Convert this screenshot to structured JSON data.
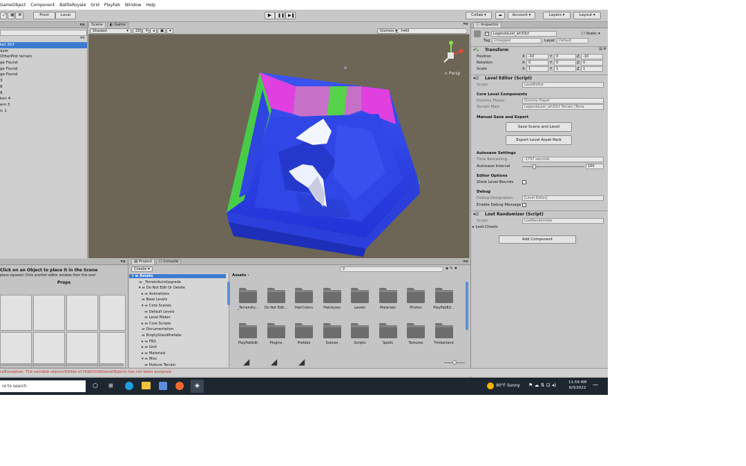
{
  "menu": {
    "items": [
      "GameObject",
      "Component",
      "BattleRoyale",
      "Grid",
      "PlayFab",
      "Window",
      "Help"
    ]
  },
  "toolbar": {
    "pivot": "Pivot",
    "local": "Local",
    "collab": "Collab",
    "account": "Account",
    "layers": "Layers",
    "layout": "Layout"
  },
  "hierarchy": {
    "rows": [
      "ket 3fcf",
      "ayer",
      "OtherPlot terrain",
      "ge Found",
      "ge Found",
      "ge Found",
      "3",
      "8",
      "8",
      "kon 4",
      "ern 3",
      "ic 1"
    ],
    "selected_index": 0
  },
  "scene": {
    "tab_scene": "Scene",
    "tab_game": "Game",
    "shaded": "Shaded",
    "mode_2d": "2D",
    "gizmos": "Gizmos",
    "search": "All",
    "persp": "< Persp"
  },
  "inspector": {
    "tab": "Inspector",
    "object_name": "LegendsLost_wh33cf",
    "static": "Static",
    "tag_label": "Tag",
    "tag_value": "Untagged",
    "layer_label": "Layer",
    "layer_value": "Default",
    "transform": "Transform",
    "position_label": "Position",
    "rotation_label": "Rotation",
    "scale_label": "Scale",
    "pos": {
      "x": "-10",
      "y": "0",
      "z": "-10"
    },
    "rot": {
      "x": "0",
      "y": "0",
      "z": "0"
    },
    "scl": {
      "x": "1",
      "y": "1",
      "z": "1"
    },
    "level_editor": "Level Editor (Script)",
    "script_label": "Script",
    "script_value": "LevelEditor",
    "core_components": "Core Level Components",
    "dummy_label": "Dummy Player",
    "dummy_value": "Dummy Player",
    "terrain_label": "Terrain Main",
    "terrain_value": "LegendsLost_wh33cf Terrain (Terra",
    "manual_save": "Manual Save and Export",
    "save_btn": "Save Scene and Level",
    "export_btn": "Export Level Asset Pack",
    "autosave": "Autosave Settings",
    "time_label": "Time Remaining",
    "time_value": "-1737 seconds",
    "interval_label": "Autosave Interval",
    "interval_value": "100",
    "editor_options": "Editor Options",
    "show_bounds": "Show Level Bounds",
    "debug": "Debug",
    "debug_designation": "Debug Designation",
    "debug_value": "[Level Editor]",
    "enable_debug": "Enable Debug Message",
    "loot": "Loot Randomizer (Script)",
    "loot_script": "LootRandomizer",
    "loot_chests": "Loot Chests",
    "add_component": "Add Component"
  },
  "props": {
    "hint": "Click on an Object to place it in the Scene",
    "hint2": "place squares! Click another editor window then this one!",
    "title": "Props"
  },
  "project": {
    "tab_project": "Project",
    "tab_console": "Console",
    "create": "Create",
    "tree": [
      "Assets",
      "_TerrainAutoUpgrade",
      "Do Not Edit Or Delete",
      "Animations",
      "Base Levels",
      "Core Scenes",
      "Default Levels",
      "Level Maker",
      "Core Scripts",
      "Documentation",
      "EmptyStandPrefabs",
      "FBX",
      "Grid",
      "Materials",
      "Misc",
      "Posture Terrain"
    ],
    "breadcrumb": "Assets",
    "folders_row1": [
      "_TerrainAu...",
      "Do Not Edit...",
      "HairColors",
      "Hairstyles",
      "Levels",
      "Materials",
      "Photon",
      "PlayFabEd..."
    ],
    "folders_row2": [
      "PlayFabSdk",
      "Plugins",
      "Prefabs",
      "Scenes",
      "Scripts",
      "Spells",
      "Textures",
      "Timberland"
    ]
  },
  "status": {
    "error": "ceException: The variable objectsToHide of HideChildGameObjects has not been assigned."
  },
  "taskbar": {
    "search": "re to search",
    "weather": "90°F Sunny",
    "time": "11:59 AM",
    "date": "6/3/2022"
  },
  "colors": {
    "selection": "#3d7bd1",
    "scene_bg": "#6d6656",
    "terrain_blue": "#2a41e8",
    "terrain_green": "#4bd44a",
    "terrain_magenta": "#e040e0"
  }
}
